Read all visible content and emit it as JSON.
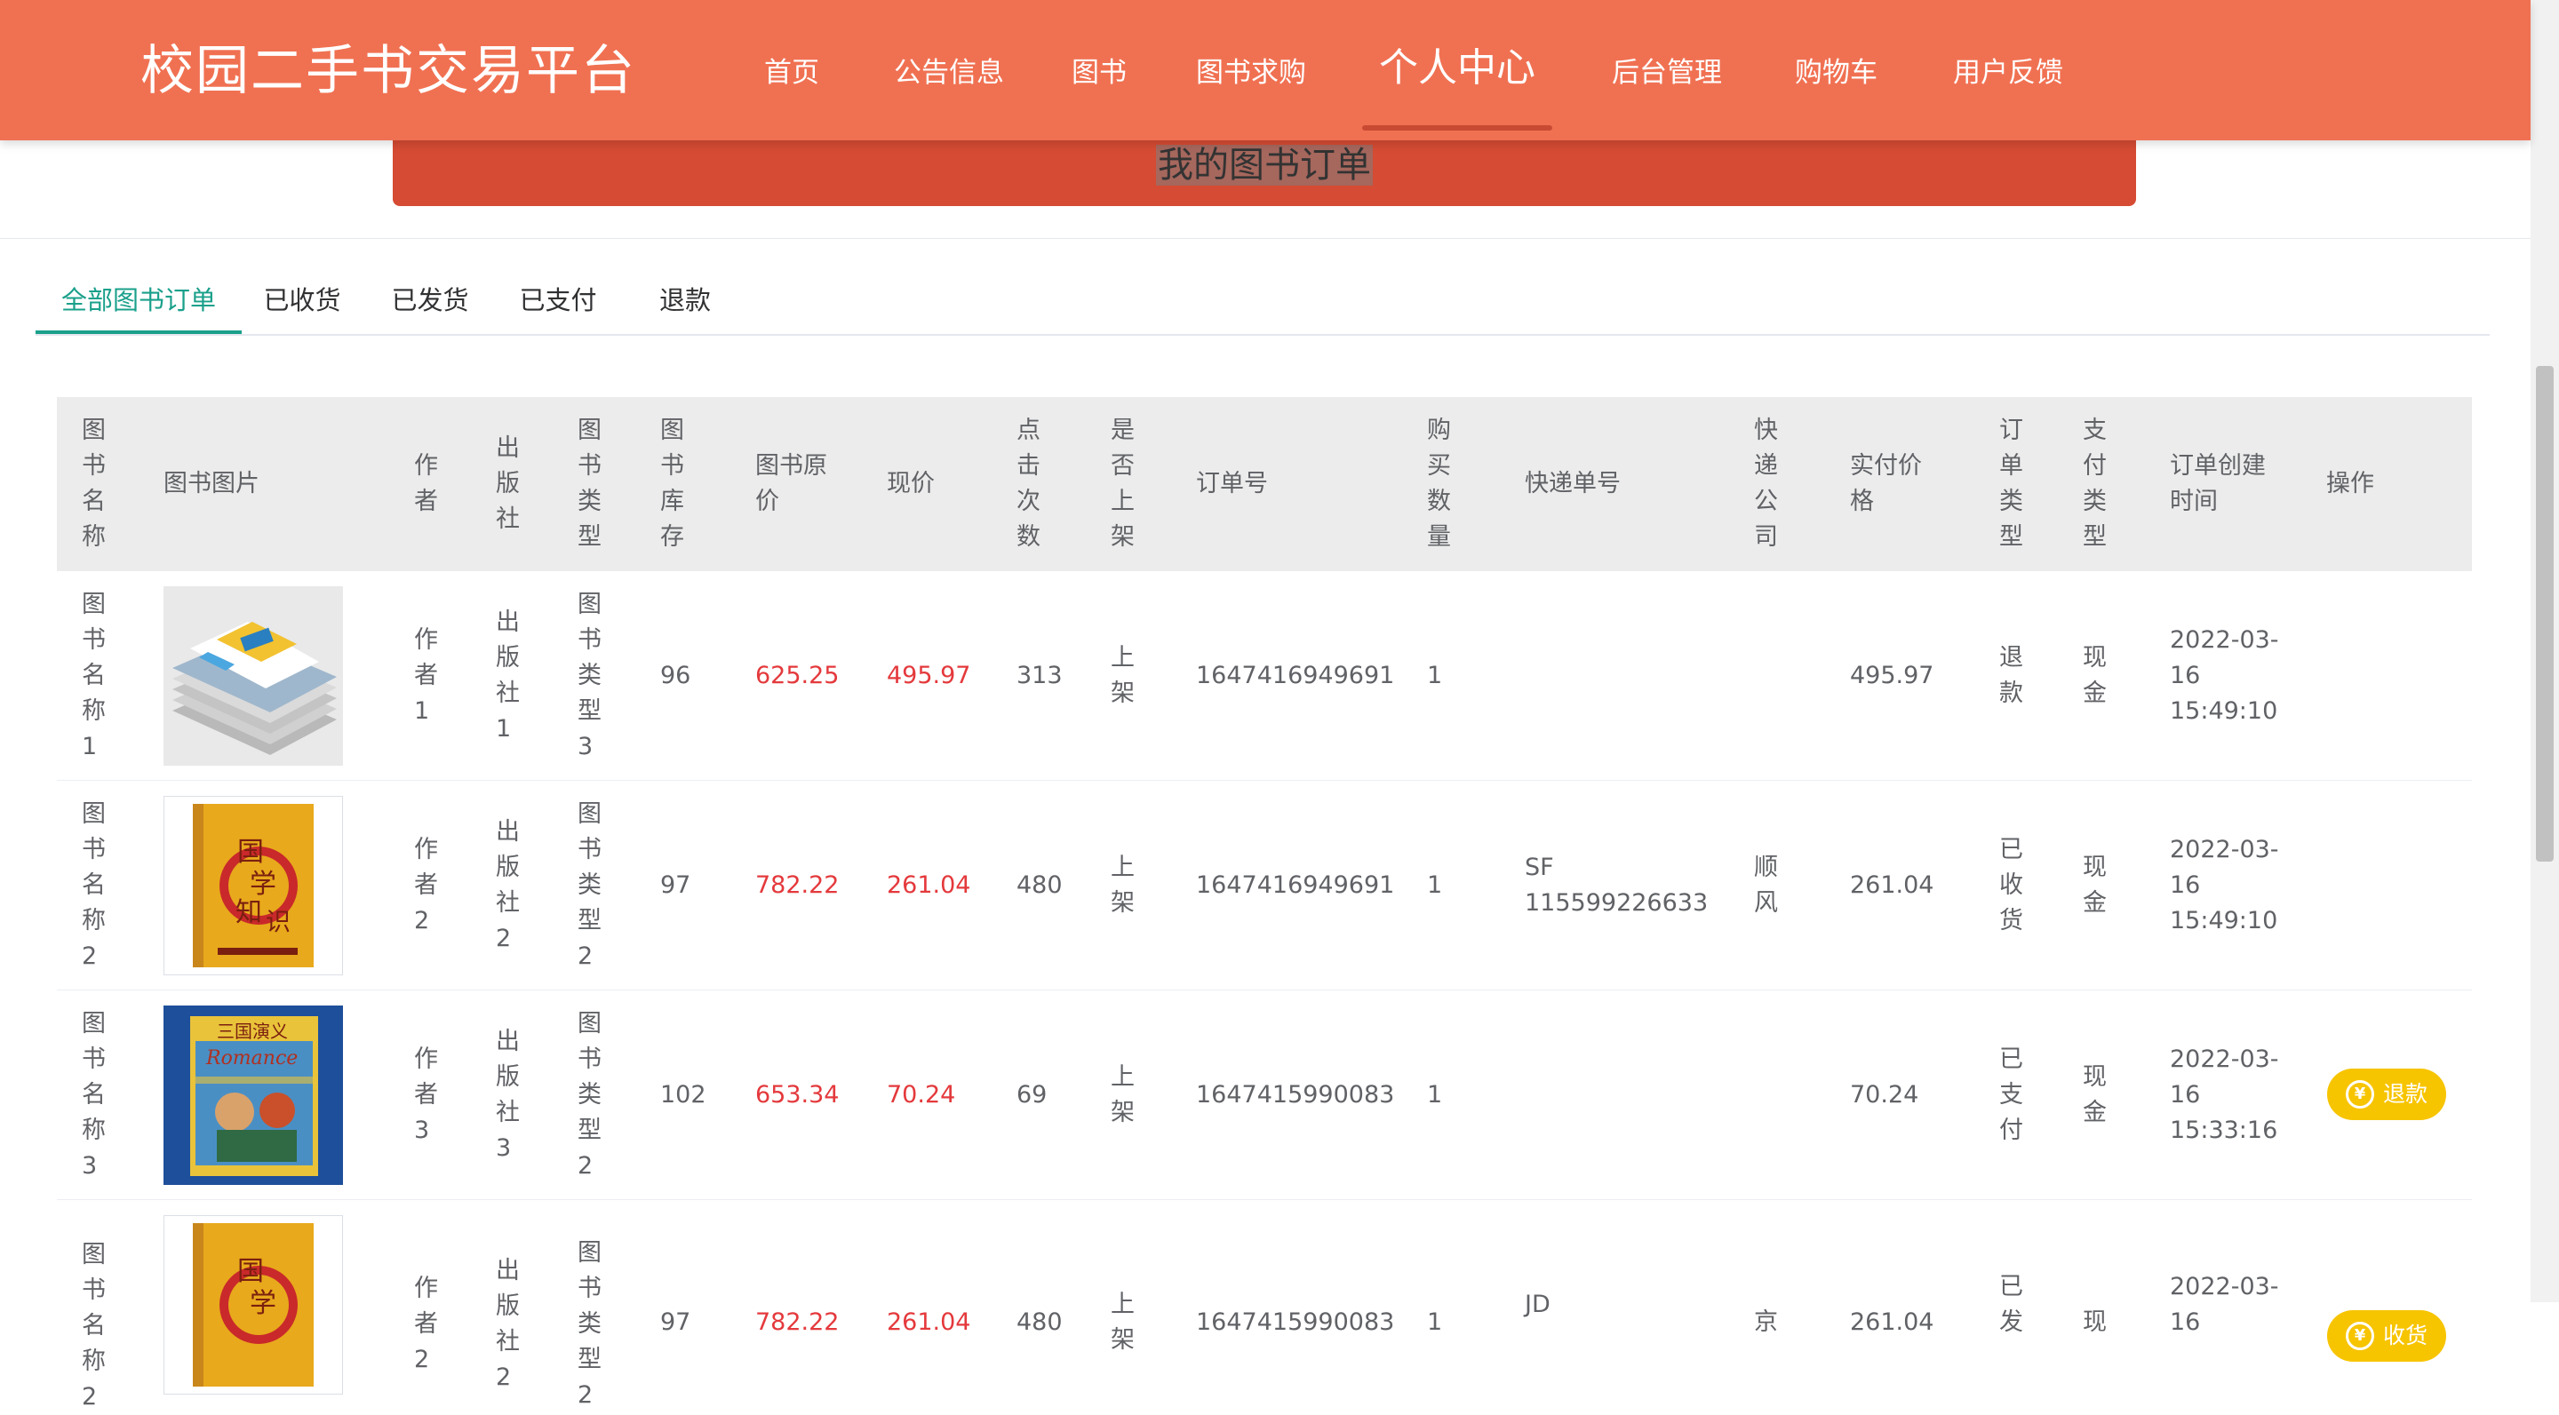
{
  "app": {
    "title": "校园二手书交易平台"
  },
  "nav": {
    "items": [
      {
        "label": "首页"
      },
      {
        "label": "公告信息"
      },
      {
        "label": "图书"
      },
      {
        "label": "图书求购"
      },
      {
        "label": "个人中心",
        "active": true
      },
      {
        "label": "后台管理"
      },
      {
        "label": "购物车"
      },
      {
        "label": "用户反馈"
      }
    ]
  },
  "page": {
    "title": "我的图书订单"
  },
  "tabs": [
    {
      "label": "全部图书订单",
      "active": true
    },
    {
      "label": "已收货"
    },
    {
      "label": "已发货"
    },
    {
      "label": "已支付"
    },
    {
      "label": "退款"
    }
  ],
  "table": {
    "headers": {
      "name": "图\n书\n名\n称",
      "image": "图书图片",
      "author": "作\n者",
      "publisher": "出\n版\n社",
      "type": "图\n书\n类\n型",
      "stock": "图\n书\n库\n存",
      "original_price": "图书原\n价",
      "price": "现价",
      "clicks": "点\n击\n次\n数",
      "on_shelf": "是\n否\n上\n架",
      "order_no": "订单号",
      "quantity": "购\n买\n数\n量",
      "tracking_no": "快递单号",
      "courier": "快\n递\n公\n司",
      "paid": "实付价\n格",
      "order_type": "订\n单\n类\n型",
      "pay_type": "支\n付\n类\n型",
      "created": "订单创建\n时间",
      "action": "操作"
    },
    "rows": [
      {
        "name": "图\n书\n名\n称\n1",
        "image_icon": "book-stack-image",
        "author": "作\n者\n1",
        "publisher": "出\n版\n社\n1",
        "type": "图\n书\n类\n型\n3",
        "stock": "96",
        "original_price": "625.25",
        "price": "495.97",
        "clicks": "313",
        "on_shelf": "上\n架",
        "order_no": "1647416949691",
        "quantity": "1",
        "tracking_no": "",
        "courier": "",
        "paid": "495.97",
        "order_type": "退\n款",
        "pay_type": "现\n金",
        "created": "2022-03-\n16\n15:49:10",
        "action": ""
      },
      {
        "name": "图\n书\n名\n称\n2",
        "image_icon": "guoxue-book-image",
        "author": "作\n者\n2",
        "publisher": "出\n版\n社\n2",
        "type": "图\n书\n类\n型\n2",
        "stock": "97",
        "original_price": "782.22",
        "price": "261.04",
        "clicks": "480",
        "on_shelf": "上\n架",
        "order_no": "1647416949691",
        "quantity": "1",
        "tracking_no": "SF\n115599226633",
        "courier": "顺\n风",
        "paid": "261.04",
        "order_type": "已\n收\n货",
        "pay_type": "现\n金",
        "created": "2022-03-\n16\n15:49:10",
        "action": ""
      },
      {
        "name": "图\n书\n名\n称\n3",
        "image_icon": "romance-book-image",
        "author": "作\n者\n3",
        "publisher": "出\n版\n社\n3",
        "type": "图\n书\n类\n型\n2",
        "stock": "102",
        "original_price": "653.34",
        "price": "70.24",
        "clicks": "69",
        "on_shelf": "上\n架",
        "order_no": "1647415990083",
        "quantity": "1",
        "tracking_no": "",
        "courier": "",
        "paid": "70.24",
        "order_type": "已\n支\n付",
        "pay_type": "现\n金",
        "created": "2022-03-\n16\n15:33:16",
        "action": "退款"
      },
      {
        "name": "图\n书\n名\n称\n2",
        "image_icon": "guoxue-book-image",
        "author": "作\n者\n2",
        "publisher": "出\n版\n社\n2",
        "type": "图\n书\n类\n型\n2",
        "stock": "97",
        "original_price": "782.22",
        "price": "261.04",
        "clicks": "480",
        "on_shelf": "上\n架",
        "order_no": "1647415990083",
        "quantity": "1",
        "tracking_no": "JD",
        "courier": "京",
        "paid": "261.04",
        "order_type": "已\n发",
        "pay_type": "现",
        "created": "2022-03-\n16",
        "action": "收货"
      }
    ]
  },
  "colors": {
    "nav_bg": "#f07152",
    "banner_bg": "#d54b33",
    "tab_active": "#1aa08b",
    "price_red": "#e4393c",
    "button_yellow": "#f7c400"
  }
}
